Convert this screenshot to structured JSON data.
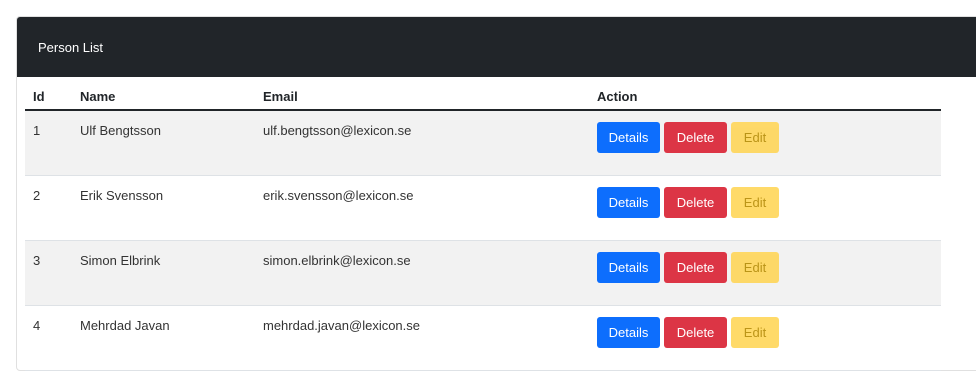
{
  "card": {
    "header_title": "Person List"
  },
  "table": {
    "columns": [
      "Id",
      "Name",
      "Email",
      "Action"
    ],
    "rows": [
      {
        "id": "1",
        "name": "Ulf Bengtsson",
        "email": "ulf.bengtsson@lexicon.se"
      },
      {
        "id": "2",
        "name": "Erik Svensson",
        "email": "erik.svensson@lexicon.se"
      },
      {
        "id": "3",
        "name": "Simon Elbrink",
        "email": "simon.elbrink@lexicon.se"
      },
      {
        "id": "4",
        "name": "Mehrdad Javan",
        "email": "mehrdad.javan@lexicon.se"
      }
    ],
    "actions": {
      "details_label": "Details",
      "delete_label": "Delete",
      "edit_label": "Edit"
    }
  },
  "colors": {
    "header_bg": "#212529",
    "details": "#0d6efd",
    "delete": "#dc3545",
    "edit": "#ffd659"
  }
}
